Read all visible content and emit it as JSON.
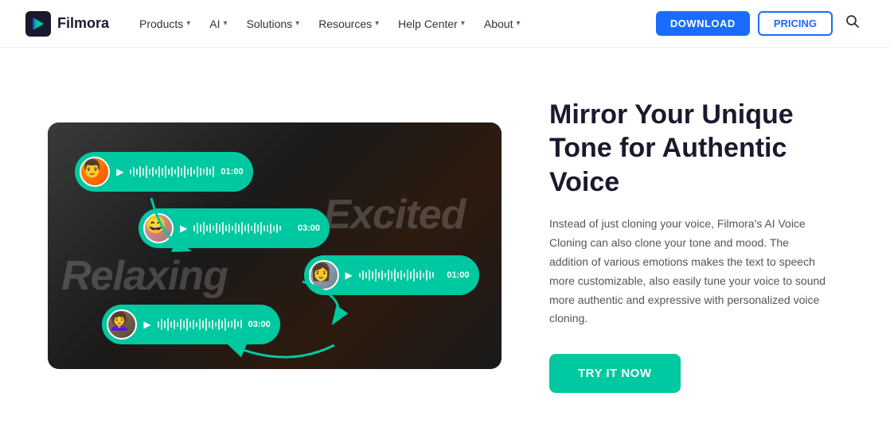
{
  "navbar": {
    "logo_text": "Filmora",
    "items": [
      {
        "label": "Products",
        "has_dropdown": true
      },
      {
        "label": "AI",
        "has_dropdown": true
      },
      {
        "label": "Solutions",
        "has_dropdown": true
      },
      {
        "label": "Resources",
        "has_dropdown": true
      },
      {
        "label": "Help Center",
        "has_dropdown": true
      },
      {
        "label": "About",
        "has_dropdown": true
      }
    ],
    "download_label": "DOWNLOAD",
    "pricing_label": "PRICING"
  },
  "hero": {
    "title": "Mirror Your Unique Tone for Authentic Voice",
    "description": "Instead of just cloning your voice, Filmora's AI Voice Cloning can also clone your tone and mood. The addition of various emotions makes the text to speech more customizable, also easily tune your voice to sound more authentic and expressive with personalized voice cloning.",
    "cta_label": "TRY IT NOW",
    "overlay_excited": "Excited",
    "overlay_relaxing": "Relaxing",
    "cards": [
      {
        "duration": "01:00",
        "position": "top-left"
      },
      {
        "duration": "03:00",
        "position": "middle-left"
      },
      {
        "duration": "01:00",
        "position": "middle-right"
      },
      {
        "duration": "03:00",
        "position": "bottom-left"
      }
    ]
  }
}
